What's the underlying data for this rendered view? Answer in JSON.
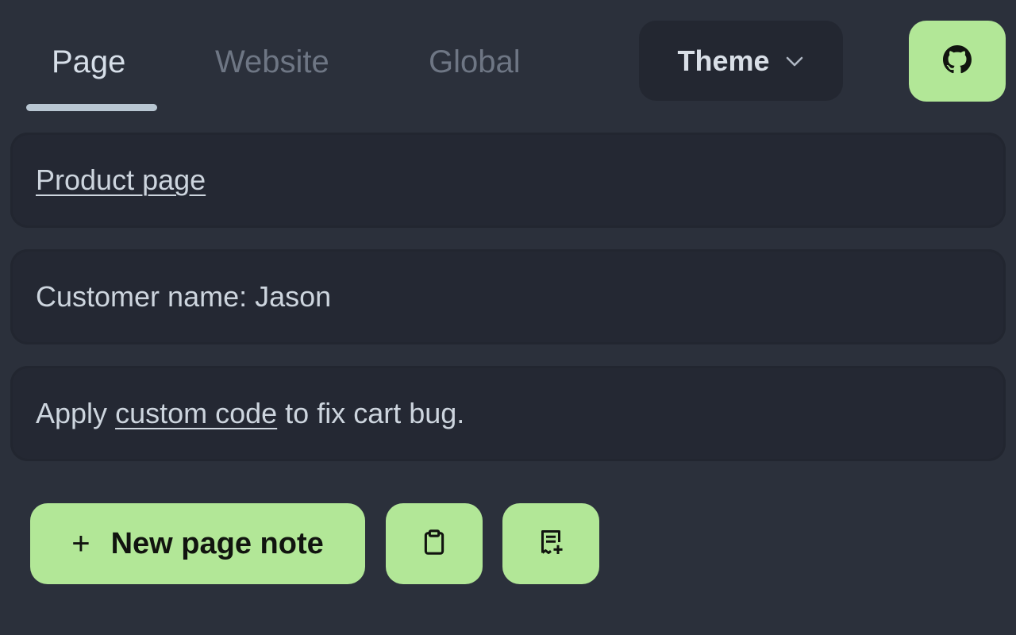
{
  "tabs": [
    {
      "label": "Page",
      "active": true
    },
    {
      "label": "Website",
      "active": false
    },
    {
      "label": "Global",
      "active": false
    }
  ],
  "theme": {
    "label": "Theme",
    "icon": "chevron-down-icon"
  },
  "github": {
    "icon": "github-icon"
  },
  "notes": [
    {
      "parts": [
        {
          "text": "Product page",
          "link": true
        }
      ]
    },
    {
      "parts": [
        {
          "text": "Customer name: Jason",
          "link": false
        }
      ]
    },
    {
      "parts": [
        {
          "text": "Apply ",
          "link": false
        },
        {
          "text": "custom code",
          "link": true
        },
        {
          "text": " to fix cart bug.",
          "link": false
        }
      ]
    }
  ],
  "actions": {
    "new_note_label": "New page note",
    "new_note_icon": "plus-icon",
    "clipboard_icon": "clipboard-icon",
    "add_note_icon": "note-add-icon"
  },
  "colors": {
    "background": "#2b303b",
    "card": "#242833",
    "accent": "#b2e797",
    "tab_active": "#d7dfe9",
    "tab_inactive": "#6e7684"
  }
}
